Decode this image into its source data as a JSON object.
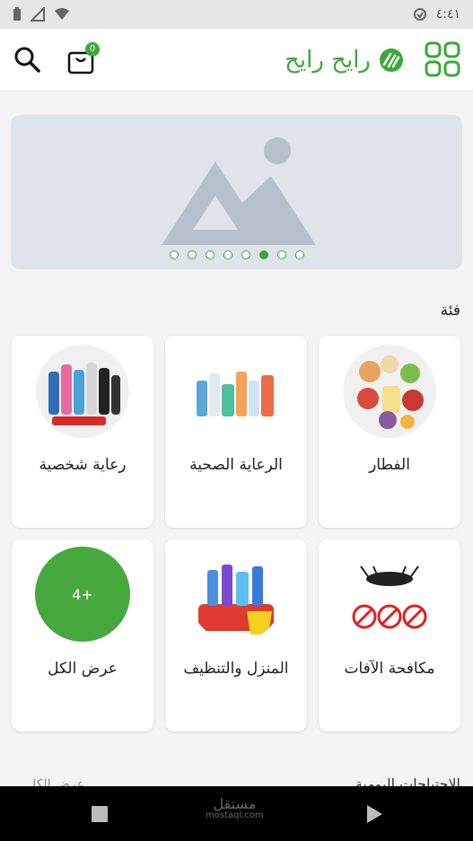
{
  "status_bar": {
    "time": "٤:٤١"
  },
  "app_bar": {
    "brand_name": "رايح رايح",
    "cart_count": "0",
    "accent_color": "#3aa83a",
    "icons": [
      "menu-grid-icon",
      "brand-logo-icon",
      "cart-icon",
      "search-icon"
    ]
  },
  "banner": {
    "slide_count": 8,
    "active_index": 5,
    "placeholder": "image-placeholder-icon"
  },
  "categories": {
    "title": "فئة",
    "items": [
      {
        "label": "الفطار",
        "image": "breakfast-food-image"
      },
      {
        "label": "الرعاية الصحية",
        "image": "healthcare-products-image"
      },
      {
        "label": "رعاية شخصية",
        "image": "personal-care-products-image"
      },
      {
        "label": "مكافحة الآفات",
        "image": "pest-control-image"
      },
      {
        "label": "المنزل والتنظيف",
        "image": "cleaning-supplies-image"
      },
      {
        "label": "عرض الكل",
        "badge": "4+"
      }
    ]
  },
  "next_section": {
    "title": "الاحتياجات اليومية",
    "view_all": "عرض الكل"
  },
  "watermark": {
    "arabic": "مستقل",
    "domain": "mostaql.com"
  }
}
